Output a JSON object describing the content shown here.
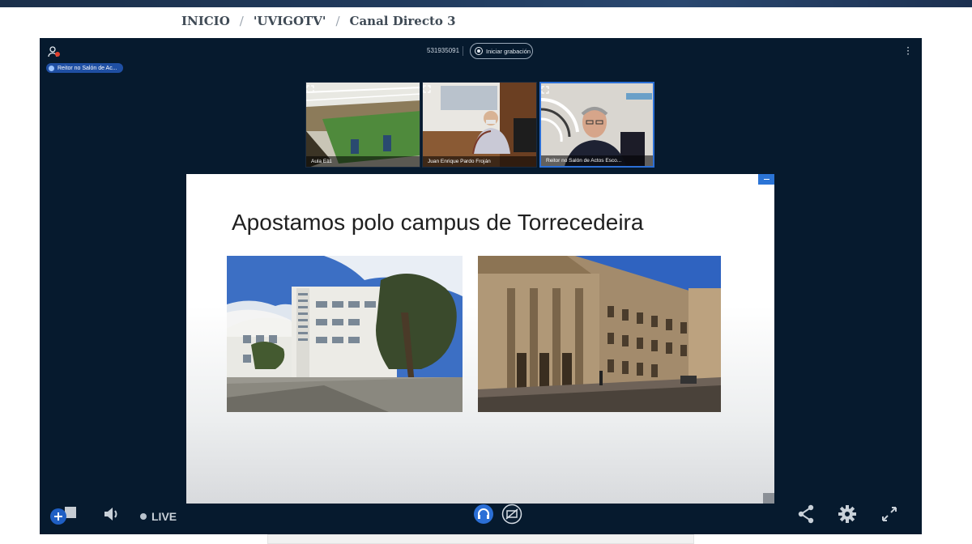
{
  "breadcrumb": {
    "items": [
      "INICIO",
      "'UVIGOTV'",
      "Canal Directo 3"
    ],
    "separator": "/"
  },
  "meeting": {
    "id": "531935091",
    "record_label": "Iniciar grabación",
    "presenter_badge": "Reitor no Salón de Ac..."
  },
  "participants": [
    {
      "name": "Aula E11"
    },
    {
      "name": "Juan Enrique Pardo Froján"
    },
    {
      "name": "Reitor no Salón de Actos Esco..."
    }
  ],
  "slide": {
    "title": "Apostamos polo campus de Torrecedeira"
  },
  "controls": {
    "live_label": "LIVE"
  },
  "colors": {
    "player_bg": "#061a2e",
    "accent_blue": "#2b74d6",
    "topbar": "#1b2f4a"
  },
  "icons": [
    "users-icon",
    "kebab-menu-icon",
    "expand-icon",
    "add-icon",
    "volume-icon",
    "headphones-icon",
    "screen-share-icon",
    "share-icon",
    "gear-icon",
    "fullscreen-icon"
  ]
}
